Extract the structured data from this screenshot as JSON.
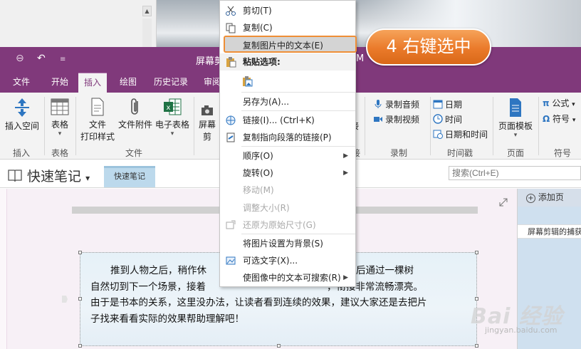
{
  "app": {
    "title": "屏幕剪",
    "title_right": "M"
  },
  "tabs": [
    {
      "label": "文件"
    },
    {
      "label": "开始"
    },
    {
      "label": "插入"
    },
    {
      "label": "绘图"
    },
    {
      "label": "历史记录"
    },
    {
      "label": "审阅"
    }
  ],
  "ribbon": {
    "insert_space": "插入空间",
    "table": "表格",
    "file_printout_1": "文件",
    "file_printout_2": "打印样式",
    "file_attachment": "文件附件",
    "spreadsheet": "电子表格",
    "screen_clip": "屏幕剪",
    "record_audio": "录制音频",
    "record_video": "录制视频",
    "date": "日期",
    "time": "时间",
    "date_time": "日期和时间",
    "page_template": "页面模板",
    "equation": "公式",
    "symbol": "符号",
    "clip_cut": "接",
    "groups": {
      "insert": "插入",
      "tables": "表格",
      "files": "文件",
      "links_cut": "接",
      "recording": "录制",
      "timestamp": "时间戳",
      "pages": "页面",
      "symbols": "符号"
    }
  },
  "notebook": {
    "name": "快速笔记",
    "section": "快速笔记",
    "search_placeholder": "搜索(Ctrl+E)"
  },
  "pages_pane": {
    "add_page": "添加页",
    "page1": "屏幕剪辑的捕获"
  },
  "note": {
    "text": "推到人物之后，稍作休整……黑幕，然后通过一棵树自然切到下一个场景，接着画面旋转的摇镜头，衔接非常流畅漂亮。由于是书本的关系，这里没办法，让读者看到连续的效果，建议大家还是去把片子找来看看实际的效果帮助理解吧！",
    "line1": "推到人物之后，稍作休",
    "line1b": "黑幕，然后通过一棵树",
    "line2a": "自然切到下一个场景，接着",
    "line2b": "，衔接非常流畅漂亮。",
    "line3": "由于是书本的关系，这里没办法，让读者看到连续的效果，建议大家还是去把片",
    "line4": "子找来看看实际的效果帮助理解吧！"
  },
  "context_menu": {
    "cut": "剪切(T)",
    "copy": "复制(C)",
    "copy_text_from_picture": "复制图片中的文本(E)",
    "paste_options": "粘贴选项:",
    "save_as": "另存为(A)...",
    "link": "链接(I)...   (Ctrl+K)",
    "copy_link_to_paragraph": "复制指向段落的链接(P)",
    "order": "顺序(O)",
    "rotate": "旋转(O)",
    "move": "移动(M)",
    "resize": "调整大小(R)",
    "restore_size": "还原为原始尺寸(G)",
    "set_as_background": "将图片设置为背景(S)",
    "alt_text": "可选文字(X)...",
    "make_text_searchable": "使图像中的文本可搜索(R)"
  },
  "callout": {
    "text": "4 右键选中"
  },
  "watermark": {
    "main": "Bai 经验",
    "sub": "jingyan.baidu.com"
  },
  "colors": {
    "onenote_purple": "#80397b",
    "highlight_border": "#ee8e36",
    "callout_orange": "#ea7a2a"
  }
}
